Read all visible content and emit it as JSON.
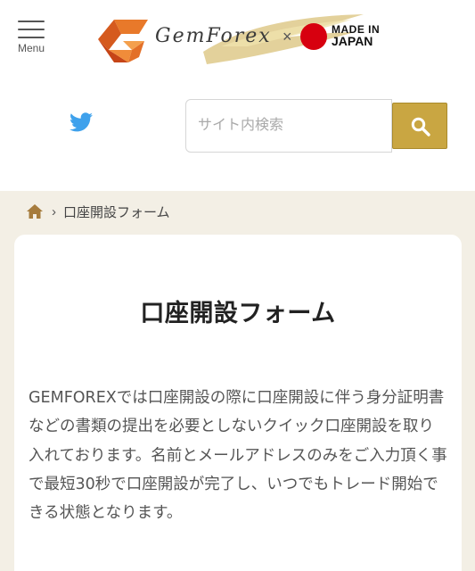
{
  "header": {
    "menu_label": "Menu",
    "logo_text": "GemForex",
    "logo_times": "×",
    "made_in_line1": "MADE IN",
    "made_in_line2": "JAPAN",
    "colors": {
      "jp_red": "#d7000f",
      "gold": "#c9a642",
      "logo_orange": "#e8792a"
    }
  },
  "search": {
    "placeholder": "サイト内検索",
    "value": "",
    "button_icon": "search-icon"
  },
  "social": {
    "icon": "twitter-icon",
    "color": "#3ea1ec"
  },
  "breadcrumb": {
    "home_icon": "home-icon",
    "separator": "›",
    "current": "口座開設フォーム"
  },
  "main": {
    "title": "口座開設フォーム",
    "intro": "GEMFOREXでは口座開設の際に口座開設に伴う身分証明書などの書類の提出を必要としないクイック口座開設を取り入れております。名前とメールアドレスのみをご入力頂く事で最短30秒で口座開設が完了し、いつでもトレード開始できる状態となります。"
  }
}
